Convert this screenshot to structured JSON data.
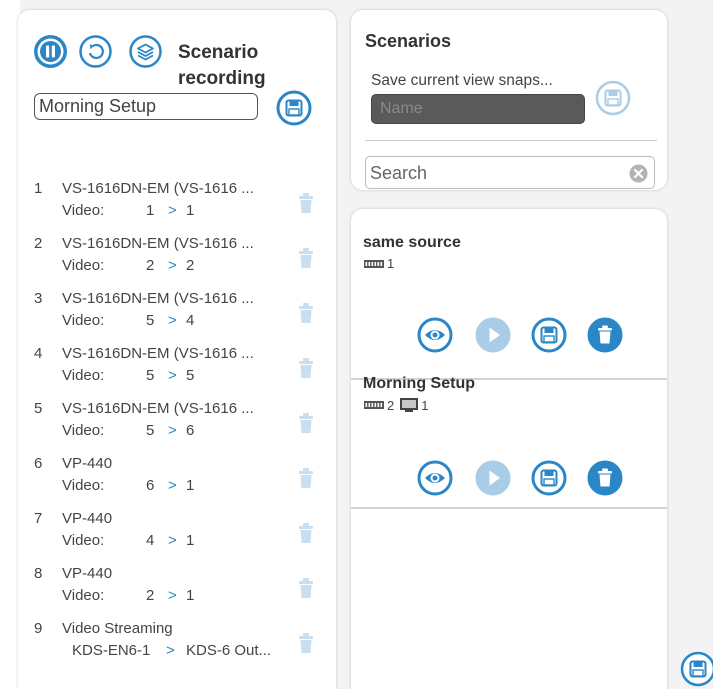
{
  "colors": {
    "accent": "#2a86c7",
    "accent_light": "#a9cde6",
    "trash_disabled": "#c7dff0"
  },
  "recording": {
    "title": "Scenario recording",
    "name_value": "Morning Setup",
    "items": [
      {
        "num": "1",
        "device": "VS-1616DN-EM (VS-1616 ...",
        "kind": "Video:",
        "from": "1",
        "to": "1"
      },
      {
        "num": "2",
        "device": "VS-1616DN-EM (VS-1616 ...",
        "kind": "Video:",
        "from": "2",
        "to": "2"
      },
      {
        "num": "3",
        "device": "VS-1616DN-EM (VS-1616 ...",
        "kind": "Video:",
        "from": "5",
        "to": "4"
      },
      {
        "num": "4",
        "device": "VS-1616DN-EM (VS-1616 ...",
        "kind": "Video:",
        "from": "5",
        "to": "5"
      },
      {
        "num": "5",
        "device": "VS-1616DN-EM (VS-1616 ...",
        "kind": "Video:",
        "from": "5",
        "to": "6"
      },
      {
        "num": "6",
        "device": "VP-440",
        "kind": "Video:",
        "from": "6",
        "to": "1"
      },
      {
        "num": "7",
        "device": "VP-440",
        "kind": "Video:",
        "from": "4",
        "to": "1"
      },
      {
        "num": "8",
        "device": "VP-440",
        "kind": "Video:",
        "from": "2",
        "to": "1"
      }
    ],
    "stream_item": {
      "num": "9",
      "device": "Video Streaming",
      "source": "KDS-EN6-1",
      "dest": "KDS-6 Out..."
    },
    "arrow": ">"
  },
  "scenarios": {
    "title": "Scenarios",
    "snapshot_label": "Save current view snaps...",
    "name_placeholder": "Name",
    "search_placeholder": "Search"
  },
  "scenario_list": [
    {
      "name": "same source",
      "switchers": "1",
      "displays": ""
    },
    {
      "name": "Morning Setup",
      "switchers": "2",
      "displays": "1"
    }
  ],
  "icons": {
    "pause": "pause-icon",
    "replay": "replay-icon",
    "layers": "layers-icon",
    "save": "floppy-disk-icon",
    "trash": "trash-icon",
    "eye": "eye-icon",
    "play": "play-icon",
    "clear": "clear-icon",
    "switcher": "switcher-icon",
    "display": "display-icon"
  }
}
